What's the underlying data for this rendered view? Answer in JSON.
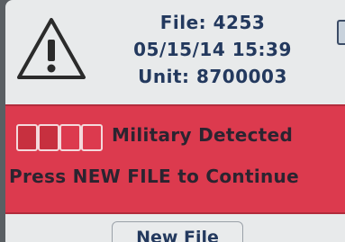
{
  "header": {
    "file_label": "File: 4253",
    "datetime": "05/15/14 15:39",
    "unit_label": "Unit: 8700003"
  },
  "alert": {
    "title": "Military Detected",
    "message": "Press NEW FILE to Continue",
    "color": "#dc3a4e"
  },
  "icons": {
    "warning": "warning-triangle-icon",
    "battery": "battery-icon",
    "indicator": "segment-indicator-icon"
  },
  "buttons": {
    "new_file": "New File"
  }
}
